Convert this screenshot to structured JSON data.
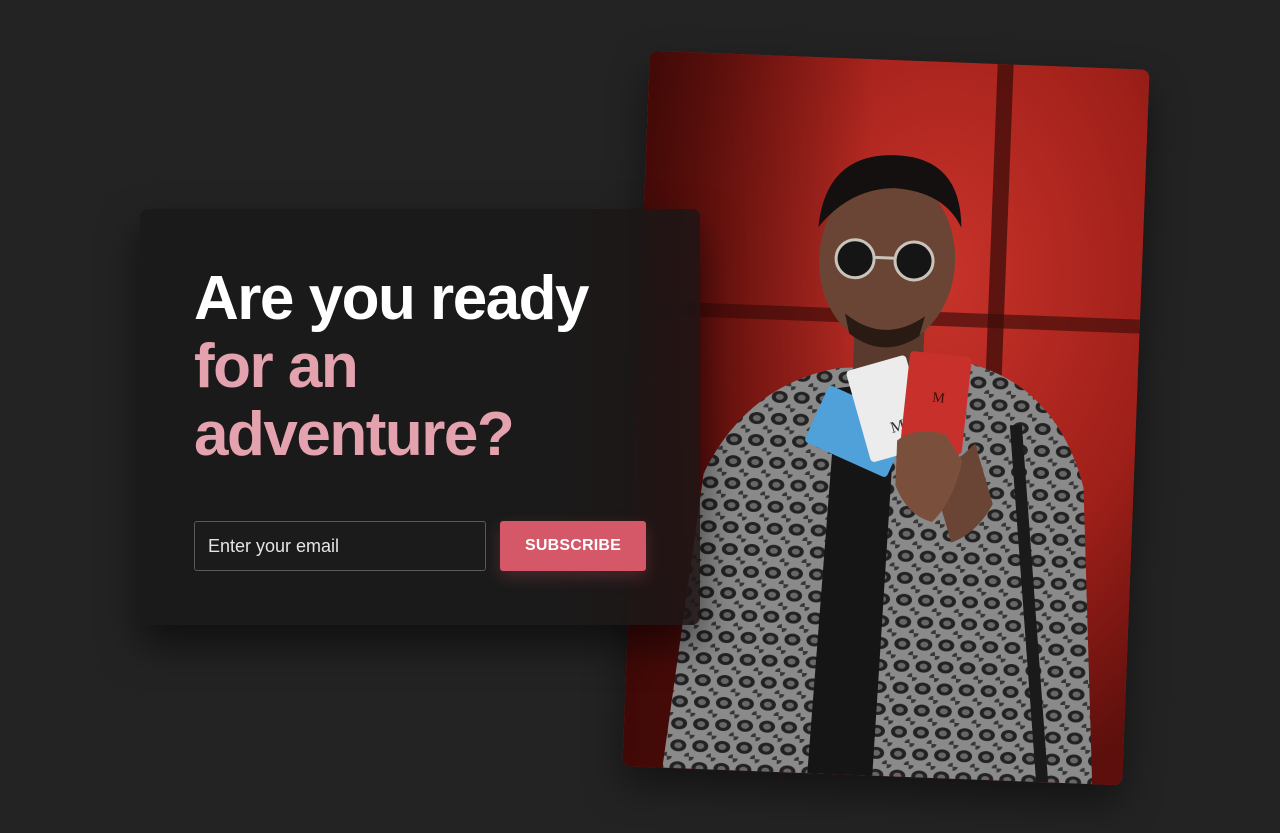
{
  "headline": {
    "line1": "Are you ready",
    "line2": "for an",
    "line3": "adventure?"
  },
  "form": {
    "email_placeholder": "Enter your email",
    "subscribe_label": "SUBSCRIBE"
  },
  "colors": {
    "background": "#232323",
    "card": "#1a1a1a",
    "accent_pink": "#e3a2ae",
    "button": "#d45868"
  },
  "image": {
    "subject": "man-in-sunglasses-holding-card-holders",
    "card_letters": [
      "M",
      "M"
    ]
  }
}
